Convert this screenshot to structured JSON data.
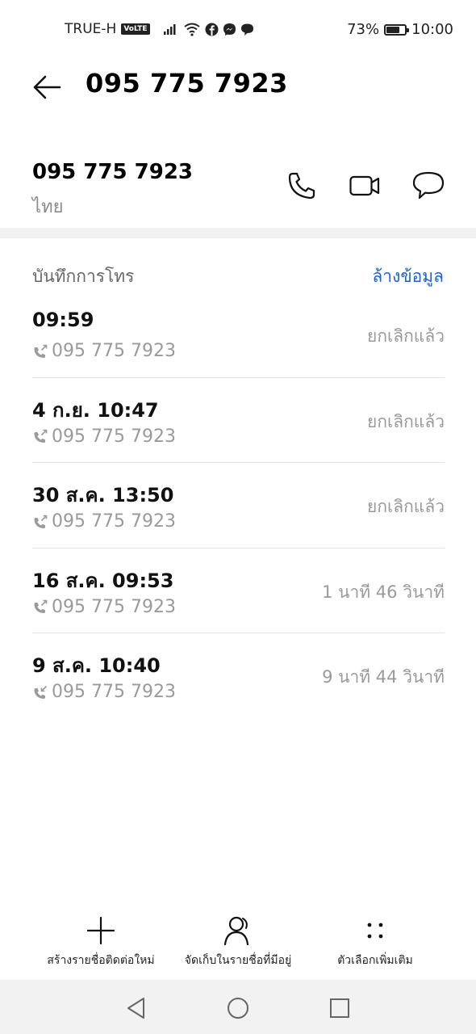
{
  "status_bar": {
    "carrier": "TRUE-H",
    "volte": "VoLTE",
    "battery_percent": "73%",
    "battery_level": 0.73,
    "time": "10:00",
    "icons": [
      "signal-icon",
      "wifi-icon",
      "facebook-icon",
      "messenger-icon",
      "chat-icon"
    ]
  },
  "header": {
    "title": "095 775 7923"
  },
  "contact": {
    "number": "095 775 7923",
    "location": "ไทย",
    "actions": [
      "phone-icon",
      "video-call-icon",
      "message-icon"
    ]
  },
  "call_log": {
    "title": "บันทึกการโทร",
    "clear_label": "ล้างข้อมูล",
    "entries": [
      {
        "time": "09:59",
        "number": "095 775 7923",
        "status": "ยกเลิกแล้ว",
        "direction": "outgoing"
      },
      {
        "time": "4 ก.ย. 10:47",
        "number": "095 775 7923",
        "status": "ยกเลิกแล้ว",
        "direction": "outgoing"
      },
      {
        "time": "30 ส.ค. 13:50",
        "number": "095 775 7923",
        "status": "ยกเลิกแล้ว",
        "direction": "outgoing"
      },
      {
        "time": "16 ส.ค. 09:53",
        "number": "095 775 7923",
        "status": "1 นาที 46 วินาที",
        "direction": "outgoing"
      },
      {
        "time": "9 ส.ค. 10:40",
        "number": "095 775 7923",
        "status": "9 นาที 44 วินาที",
        "direction": "incoming"
      }
    ]
  },
  "bottom_actions": {
    "new_contact": "สร้างรายชื่อติดต่อใหม่",
    "save_existing": "จัดเก็บในรายชื่อที่มีอยู่",
    "more_options": "ตัวเลือกเพิ่มเติม"
  },
  "colors": {
    "accent": "#1a62d6",
    "secondary_text": "#9a9a9a",
    "divider": "#e4e4e4"
  }
}
